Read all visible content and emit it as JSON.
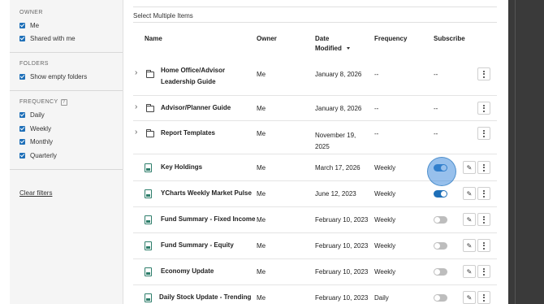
{
  "sidebar": {
    "owner": {
      "heading": "OWNER",
      "items": [
        "Me",
        "Shared with me"
      ]
    },
    "folders": {
      "heading": "FOLDERS",
      "items": [
        "Show empty folders"
      ]
    },
    "frequency": {
      "heading": "FREQUENCY",
      "help": "?",
      "items": [
        "Daily",
        "Weekly",
        "Monthly",
        "Quarterly"
      ]
    },
    "clear_filters": "Clear filters"
  },
  "main": {
    "select_multiple": "Select Multiple Items",
    "columns": {
      "name": "Name",
      "owner": "Owner",
      "date": "Date",
      "modified": "Modified",
      "frequency": "Frequency",
      "subscribe": "Subscribe"
    },
    "rows": [
      {
        "type": "folder",
        "name": "Home Office/Advisor",
        "name2": "Leadership Guide",
        "owner": "Me",
        "date": "January 8, 2026",
        "date2": "",
        "frequency": "--",
        "subscribe": "--"
      },
      {
        "type": "folder",
        "name": "Advisor/Planner Guide",
        "name2": "",
        "owner": "Me",
        "date": "January 8, 2026",
        "date2": "",
        "frequency": "--",
        "subscribe": "--"
      },
      {
        "type": "folder",
        "name": "Report Templates",
        "name2": "",
        "owner": "Me",
        "date": "November 19,",
        "date2": "2025",
        "frequency": "--",
        "subscribe": "--"
      },
      {
        "type": "report",
        "name": "Key Holdings",
        "name2": "",
        "owner": "Me",
        "date": "March 17, 2026",
        "date2": "",
        "frequency": "Weekly",
        "subscribed": true
      },
      {
        "type": "report",
        "name": "YCharts Weekly Market Pulse",
        "name2": "",
        "owner": "Me",
        "date": "June 12, 2023",
        "date2": "",
        "frequency": "Weekly",
        "subscribed": true
      },
      {
        "type": "report",
        "name": "Fund Summary - Fixed Income",
        "name2": "",
        "owner": "Me",
        "date": "February 10, 2023",
        "date2": "",
        "frequency": "Weekly",
        "subscribed": false
      },
      {
        "type": "report",
        "name": "Fund Summary - Equity",
        "name2": "",
        "owner": "Me",
        "date": "February 10, 2023",
        "date2": "",
        "frequency": "Weekly",
        "subscribed": false
      },
      {
        "type": "report",
        "name": "Economy Update",
        "name2": "",
        "owner": "Me",
        "date": "February 10, 2023",
        "date2": "",
        "frequency": "Weekly",
        "subscribed": false
      },
      {
        "type": "report",
        "name": "Daily Stock Update - Trending",
        "name2": "",
        "owner": "Me",
        "date": "February 10, 2023",
        "date2": "",
        "frequency": "Daily",
        "subscribed": false
      }
    ]
  },
  "colors": {
    "accent": "#1e6fb8",
    "doc_icon": "#2d7d6a"
  }
}
